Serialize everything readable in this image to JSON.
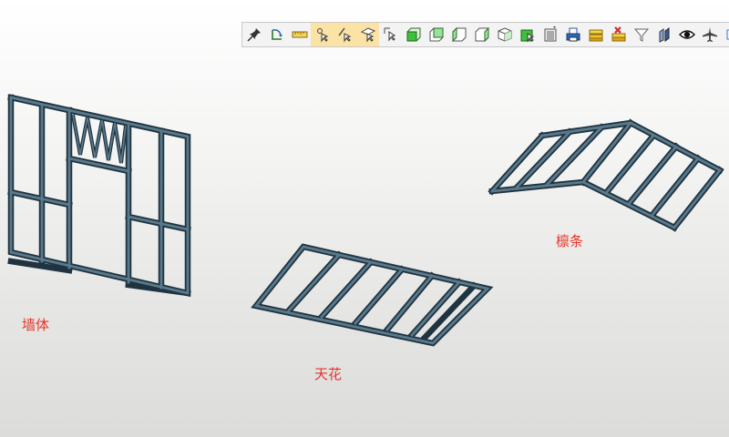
{
  "toolbar": {
    "buttons": [
      {
        "icon": "pin-icon",
        "active": false
      },
      {
        "icon": "rotate-icon",
        "active": false
      },
      {
        "icon": "ruler-icon",
        "active": false
      },
      {
        "icon": "select-point-icon",
        "active": true
      },
      {
        "icon": "select-edge-icon",
        "active": true
      },
      {
        "icon": "select-face-icon",
        "active": true
      },
      {
        "icon": "select-object-icon",
        "active": false
      },
      {
        "icon": "view-front-icon",
        "active": false
      },
      {
        "icon": "view-back-icon",
        "active": false
      },
      {
        "icon": "view-left-icon",
        "active": false
      },
      {
        "icon": "view-right-icon",
        "active": false
      },
      {
        "icon": "view-iso-icon",
        "active": false
      },
      {
        "icon": "view-top-icon",
        "active": false
      },
      {
        "icon": "layers-icon",
        "active": false
      },
      {
        "icon": "print-icon",
        "active": false
      },
      {
        "icon": "layer-stack-icon",
        "active": false
      },
      {
        "icon": "delete-icon",
        "active": false
      },
      {
        "icon": "filter-icon",
        "active": false
      },
      {
        "icon": "section-icon",
        "active": false
      },
      {
        "icon": "visibility-eye-icon",
        "active": false
      },
      {
        "icon": "fly-icon",
        "active": false
      },
      {
        "icon": "more-icon",
        "active": false
      }
    ]
  },
  "labels": {
    "wall": "墙体",
    "ceiling": "天花",
    "purlin": "檩条"
  },
  "colors": {
    "frame": "#3d5869",
    "frame_dark": "#1f3340",
    "label": "#e8332a",
    "toolbar_active": "#fbe3a6"
  }
}
